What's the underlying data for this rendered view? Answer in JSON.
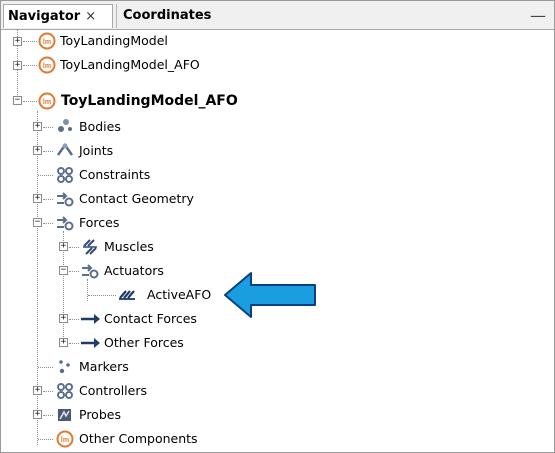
{
  "tabs": {
    "navigator": "Navigator",
    "navigator_close": "×",
    "coordinates": "Coordinates",
    "minimize": "—"
  },
  "tree": {
    "models": [
      {
        "label": "ToyLandingModel",
        "expanded": false
      },
      {
        "label": "ToyLandingModel_AFO",
        "expanded": false
      },
      {
        "label": "ToyLandingModel_AFO",
        "expanded": true,
        "current": true
      }
    ],
    "children": [
      {
        "label": "Bodies",
        "icon": "bodies-icon",
        "expanded": false
      },
      {
        "label": "Joints",
        "icon": "joints-icon",
        "expanded": false
      },
      {
        "label": "Constraints",
        "icon": "constraints-icon",
        "leaf": true
      },
      {
        "label": "Contact Geometry",
        "icon": "contact-geometry-icon",
        "expanded": false
      },
      {
        "label": "Forces",
        "icon": "forces-icon",
        "expanded": true
      },
      {
        "label": "Muscles",
        "icon": "muscles-icon",
        "expanded": false
      },
      {
        "label": "Actuators",
        "icon": "actuators-icon",
        "expanded": true
      },
      {
        "label": "ActiveAFO",
        "icon": "actuator-icon",
        "leaf": true
      },
      {
        "label": "Contact Forces",
        "icon": "contact-forces-icon",
        "expanded": false
      },
      {
        "label": "Other Forces",
        "icon": "other-forces-icon",
        "expanded": false
      },
      {
        "label": "Markers",
        "icon": "markers-icon",
        "leaf": true
      },
      {
        "label": "Controllers",
        "icon": "controllers-icon",
        "expanded": false
      },
      {
        "label": "Probes",
        "icon": "probes-icon",
        "expanded": false
      },
      {
        "label": "Other Components",
        "icon": "other-components-icon",
        "leaf": true
      }
    ]
  },
  "colors": {
    "model_icon": "#e07a30",
    "arrow_fill": "#1a9ee0",
    "arrow_stroke": "#0a3f86",
    "group_icon": "#5a6f8c"
  }
}
